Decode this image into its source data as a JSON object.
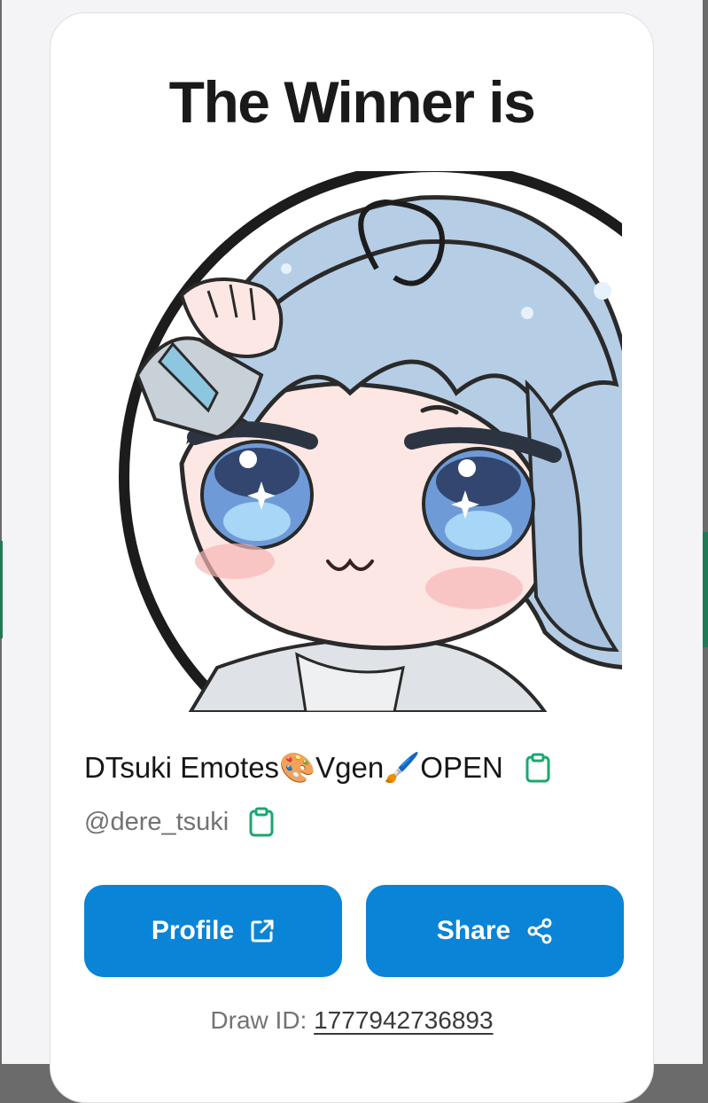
{
  "card": {
    "title": "The Winner is"
  },
  "winner": {
    "display_name": "DTsuki Emotes🎨Vgen🖌️OPEN",
    "handle": "@dere_tsuki",
    "avatar_icon": "chibi-character-saluting"
  },
  "actions": {
    "profile_label": "Profile",
    "profile_icon": "external-link-icon",
    "share_label": "Share",
    "share_icon": "share-icon",
    "copy_icon": "clipboard-icon"
  },
  "draw": {
    "label": "Draw ID:",
    "id": "1777942736893"
  },
  "colors": {
    "accent_button": "#0a84d6",
    "copy_icon": "#1aa870",
    "title_text": "#1a1a1a"
  }
}
